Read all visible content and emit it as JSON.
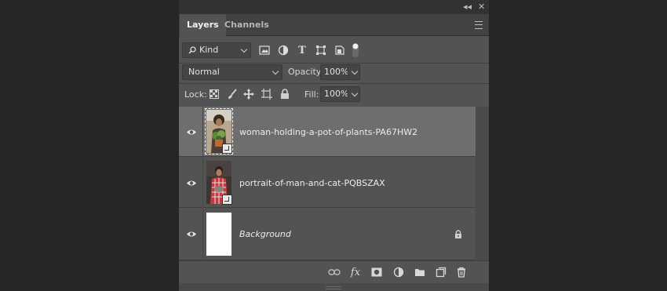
{
  "window": {
    "collapse_glyph": "◂◂",
    "close_glyph": "✕"
  },
  "tabs": [
    {
      "label": "Layers",
      "active": true
    },
    {
      "label": "Channels",
      "active": false
    }
  ],
  "filter": {
    "kind_label": "Kind",
    "icons": [
      "image-filter-icon",
      "adjustment-filter-icon",
      "type-filter-icon",
      "shape-filter-icon",
      "smart-object-filter-icon",
      "filter-toggle-icon"
    ]
  },
  "blend": {
    "mode": "Normal",
    "opacity_label": "Opacity:",
    "opacity_value": "100%"
  },
  "lock": {
    "label": "Lock:",
    "fill_label": "Fill:",
    "fill_value": "100%",
    "icons": [
      "lock-transparent-pixels-icon",
      "lock-image-pixels-icon",
      "lock-position-icon",
      "prevent-auto-nesting-icon",
      "lock-all-icon"
    ]
  },
  "layers": [
    {
      "name": "woman-holding-a-pot-of-plants-PA67HW2",
      "selected": true,
      "visible": true,
      "smart_object": true
    },
    {
      "name": "portrait-of-man-and-cat-PQBSZAX",
      "selected": false,
      "visible": true,
      "smart_object": true
    },
    {
      "name": "Background",
      "selected": false,
      "visible": true,
      "locked": true,
      "italic": true
    }
  ],
  "footer_icons": [
    "link-layers-icon",
    "fx-icon",
    "add-mask-icon",
    "new-adjustment-layer-icon",
    "new-group-icon",
    "new-layer-icon",
    "delete-layer-icon"
  ],
  "colors": {
    "panel_bg": "#535353",
    "selected_row": "#6e6e6e",
    "app_bg": "#262626"
  }
}
